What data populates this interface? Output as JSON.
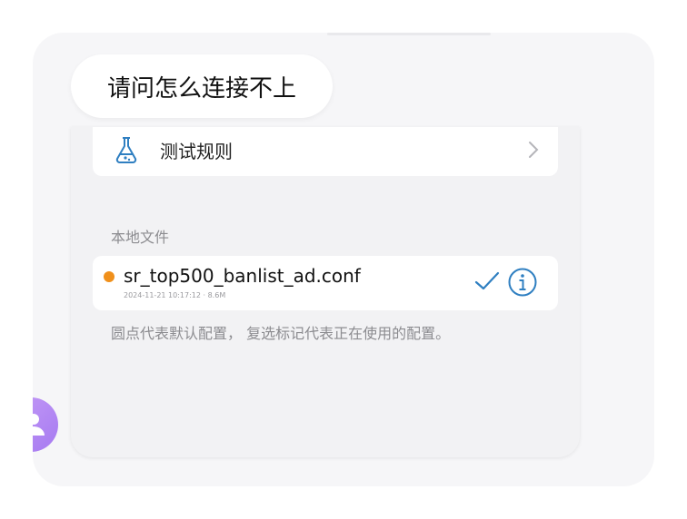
{
  "chat": {
    "message": "请问怎么连接不上"
  },
  "screenshot": {
    "rules_row": {
      "label": "测试规则",
      "icon": "flask-icon"
    },
    "local_files": {
      "section_title": "本地文件",
      "files": [
        {
          "name": "sr_top500_banlist_ad.conf",
          "meta": "2024-11-21 10:17:12 · 8.6M",
          "selected": true,
          "default": true
        }
      ],
      "note": "圆点代表默认配置， 复选标记代表正在使用的配置。"
    }
  },
  "colors": {
    "accent": "#2f7fc1",
    "default_dot": "#f0901b",
    "avatar": "#b88af4"
  }
}
